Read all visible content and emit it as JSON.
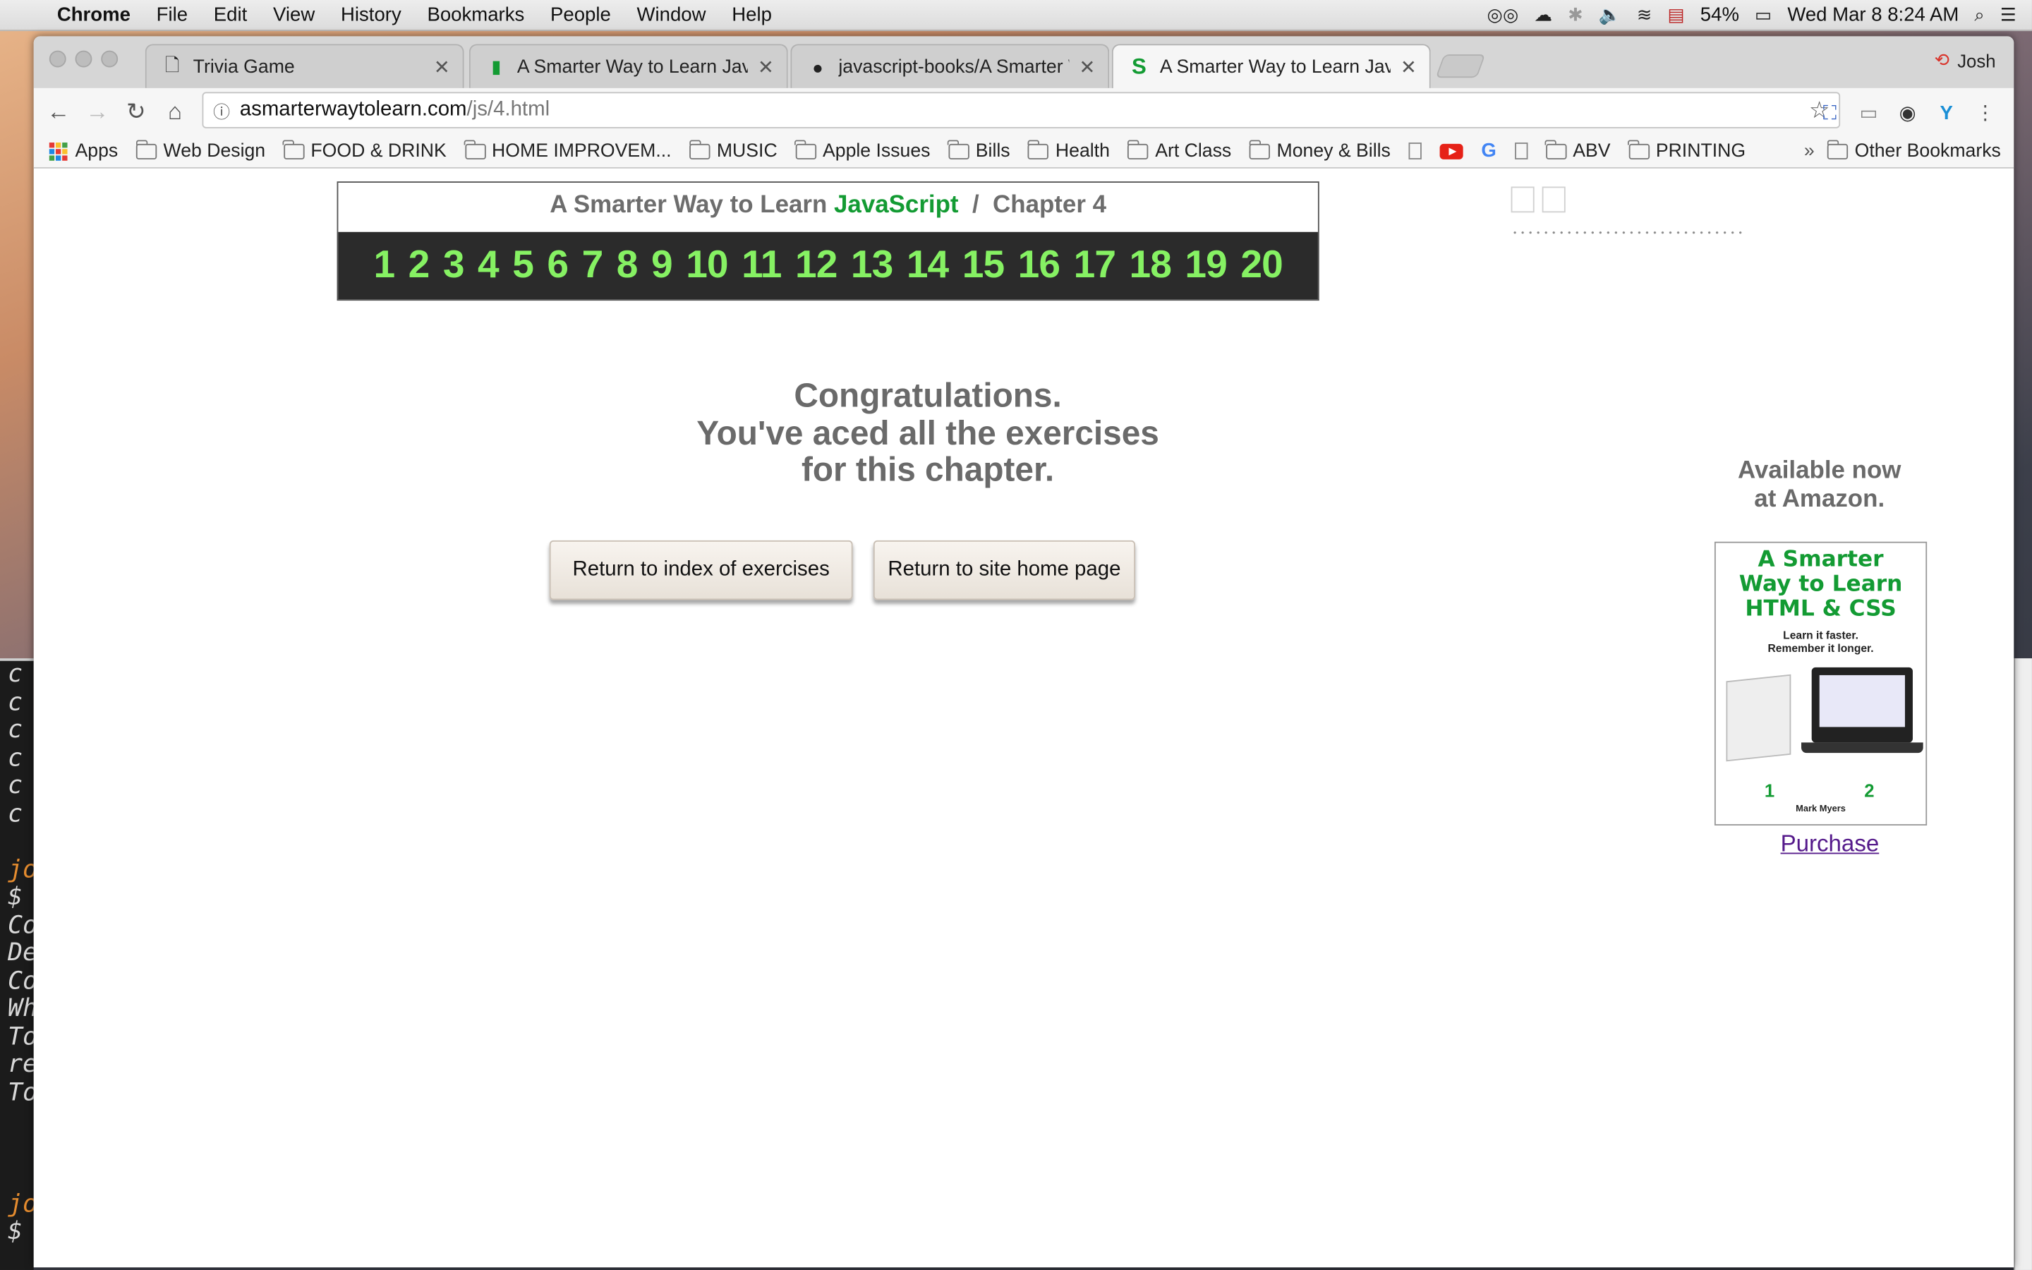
{
  "menubar": {
    "app": "Chrome",
    "items": [
      "File",
      "Edit",
      "View",
      "History",
      "Bookmarks",
      "People",
      "Window",
      "Help"
    ],
    "battery": "54%",
    "clock": "Wed Mar 8  8:24 AM"
  },
  "tabs": [
    {
      "title": "Trivia Game",
      "icon": "page-icon"
    },
    {
      "title": "A Smarter Way to Learn JavaS",
      "icon": "book-icon"
    },
    {
      "title": "javascript-books/A Smarter W",
      "icon": "github-icon"
    },
    {
      "title": "A Smarter Way to Learn JavaS",
      "icon": "s-logo-icon",
      "active": true
    }
  ],
  "profile": "Josh",
  "address": {
    "host": "asmarterwaytolearn.com",
    "path": "/js/4.html"
  },
  "bookmarks": [
    "Apps",
    "Web Design",
    "FOOD & DRINK",
    "HOME IMPROVEM...",
    "MUSIC",
    "Apple Issues",
    "Bills",
    "Health",
    "Art Class",
    "Money & Bills",
    "ABV",
    "PRINTING"
  ],
  "bookmarks_more": "»",
  "other_bookmarks": "Other Bookmarks",
  "page": {
    "header_prefix": "A Smarter Way to Learn ",
    "header_js": "JavaScript",
    "header_sep": "  /  ",
    "header_chapter": "Chapter 4",
    "chapters": [
      "1",
      "2",
      "3",
      "4",
      "5",
      "6",
      "7",
      "8",
      "9",
      "10",
      "11",
      "12",
      "13",
      "14",
      "15",
      "16",
      "17",
      "18",
      "19",
      "20"
    ],
    "congrats_lines": [
      "Congratulations.",
      "You've aced all the exercises",
      "for this chapter."
    ],
    "btn_index": "Return to index of exercises",
    "btn_home": "Return to site home page",
    "available": [
      "Available now",
      "at Amazon."
    ],
    "book_title": [
      "A Smarter",
      "Way to Learn",
      "HTML & CSS"
    ],
    "book_subtitle": [
      "Learn it faster.",
      "Remember it longer."
    ],
    "book_author": "Mark Myers",
    "purchase": "Purchase"
  },
  "terminal_lines": [
    "c",
    "c",
    "c",
    "c",
    "c",
    "c",
    "",
    "jo",
    "$",
    "Co",
    "De",
    "Co",
    "Wh",
    "To",
    "re",
    "To",
    "",
    "",
    "",
    "jo",
    "$"
  ],
  "colors": {
    "accent_green": "#139b33",
    "chapter_green": "#86f163",
    "link_purple": "#551a8b"
  }
}
